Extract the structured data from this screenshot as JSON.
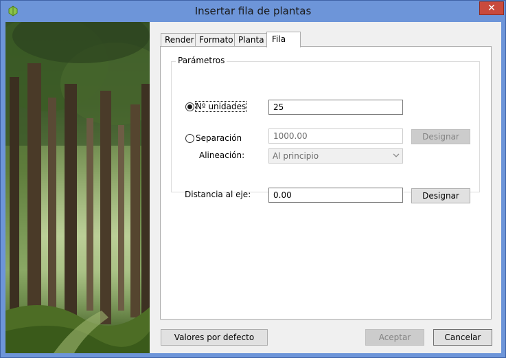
{
  "window": {
    "title": "Insertar fila de plantas",
    "close_label": "✕"
  },
  "tabs": [
    {
      "label": "Render"
    },
    {
      "label": "Formato"
    },
    {
      "label": "Planta"
    },
    {
      "label": "Fila",
      "active": true
    }
  ],
  "parametros": {
    "group_title": "Parámetros",
    "units": {
      "label": "Nº unidades",
      "selected": true,
      "value": "25"
    },
    "separacion": {
      "label": "Separación",
      "selected": false,
      "value": "1000.00",
      "button_label": "Designar"
    },
    "alineacion": {
      "label": "Alineación:",
      "value": "Al principio"
    },
    "distancia": {
      "label": "Distancia al eje:",
      "value": "0.00",
      "button_label": "Designar"
    }
  },
  "footer": {
    "defaults_label": "Valores por defecto",
    "accept_label": "Aceptar",
    "cancel_label": "Cancelar"
  },
  "colors": {
    "titlebar": "#6d95d9",
    "close": "#c94a3d",
    "dialog_bg": "#f0f0f0"
  }
}
